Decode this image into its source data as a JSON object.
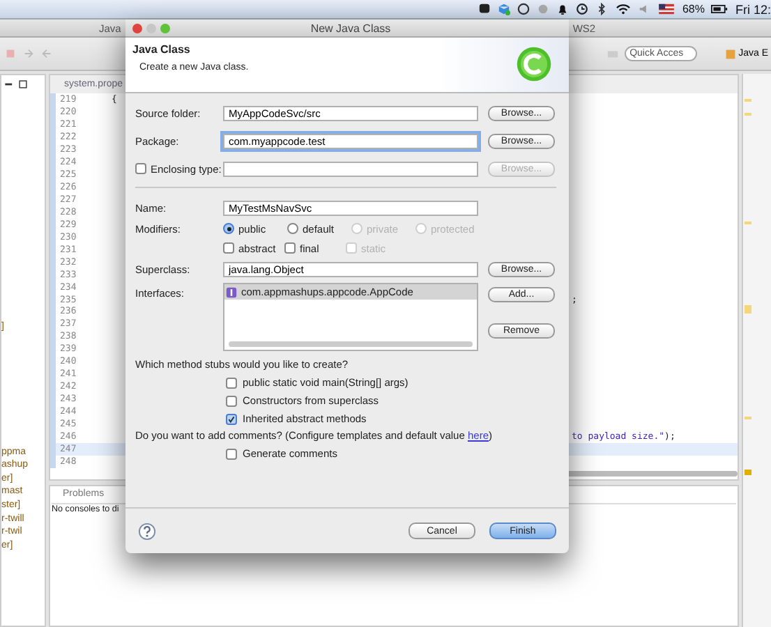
{
  "menubar": {
    "battery": "68%",
    "clock": "Fri 12:"
  },
  "window": {
    "title_left": "Java",
    "title_right": "WS2"
  },
  "toolbar": {
    "quick_access": {
      "placeholder": "Quick Acces"
    },
    "perspective": "Java E"
  },
  "left_panel": {
    "items": [
      {
        "text": "]",
        "selected": false
      },
      {
        "text": "ppma",
        "selected": false
      },
      {
        "text": "ashup",
        "selected": false
      },
      {
        "text": "er]",
        "selected": false
      },
      {
        "text": "mast",
        "selected": false
      },
      {
        "text": "ster]",
        "selected": false
      },
      {
        "text": "r-twill",
        "selected": false
      },
      {
        "text": "r-twil",
        "selected": false
      },
      {
        "text": "er]",
        "selected": false
      }
    ]
  },
  "editor": {
    "tab": "system.prope",
    "lines": [
      {
        "number": "219",
        "code": "{",
        "highlighted": false
      },
      {
        "number": "220",
        "highlighted": false
      },
      {
        "number": "221",
        "highlighted": false
      },
      {
        "number": "222",
        "highlighted": false
      },
      {
        "number": "223",
        "highlighted": false
      },
      {
        "number": "224",
        "highlighted": false
      },
      {
        "number": "225",
        "highlighted": false
      },
      {
        "number": "226",
        "highlighted": false
      },
      {
        "number": "227",
        "highlighted": false
      },
      {
        "number": "228",
        "highlighted": false
      },
      {
        "number": "229",
        "highlighted": false
      },
      {
        "number": "230",
        "highlighted": false
      },
      {
        "number": "231",
        "highlighted": false
      },
      {
        "number": "232",
        "highlighted": false
      },
      {
        "number": "233",
        "highlighted": false
      },
      {
        "number": "234",
        "highlighted": false
      },
      {
        "number": "235",
        "tail": ";",
        "highlighted": false
      },
      {
        "number": "236",
        "highlighted": false
      },
      {
        "number": "237",
        "highlighted": false
      },
      {
        "number": "238",
        "highlighted": false
      },
      {
        "number": "239",
        "highlighted": false
      },
      {
        "number": "240",
        "highlighted": false
      },
      {
        "number": "241",
        "highlighted": false
      },
      {
        "number": "242",
        "highlighted": false
      },
      {
        "number": "243",
        "highlighted": false
      },
      {
        "number": "244",
        "highlighted": false
      },
      {
        "number": "245",
        "highlighted": false
      },
      {
        "number": "246",
        "tail_string": "to payload size.\"",
        "tail": ");",
        "highlighted": false
      },
      {
        "number": "247",
        "highlighted": true
      },
      {
        "number": "248",
        "highlighted": false
      }
    ]
  },
  "bottom_panel": {
    "tab": "Problems",
    "message": "No consoles to di"
  },
  "dialog": {
    "title": "New Java Class",
    "header": {
      "title": "Java Class",
      "message": "Create a new Java class."
    },
    "rows": [
      {
        "kind": "field",
        "label": "Source folder:",
        "value": "MyAppCodeSvc/src",
        "focused": false,
        "button": "Browse...",
        "button_disabled": false
      },
      {
        "kind": "field",
        "label": "Package:",
        "value": "com.myappcode.test",
        "focused": true,
        "button": "Browse...",
        "button_disabled": false
      },
      {
        "kind": "check",
        "label": "Enclosing type:",
        "checked": false,
        "focused": false,
        "button": "Browse...",
        "button_disabled": true
      }
    ],
    "name": {
      "label": "Name:",
      "value": "MyTestMsNavSvc"
    },
    "modifiers": {
      "label": "Modifiers:",
      "access": [
        {
          "label": "public",
          "selected": true,
          "disabled": false
        },
        {
          "label": "default",
          "selected": false,
          "disabled": false
        },
        {
          "label": "private",
          "selected": false,
          "disabled": true
        },
        {
          "label": "protected",
          "selected": false,
          "disabled": true
        }
      ],
      "flags": [
        {
          "label": "abstract",
          "checked": false,
          "disabled": false
        },
        {
          "label": "final",
          "checked": false,
          "disabled": false
        },
        {
          "label": "static",
          "checked": false,
          "disabled": true
        }
      ]
    },
    "superclass": {
      "label": "Superclass:",
      "value": "java.lang.Object",
      "button": "Browse..."
    },
    "interfaces": {
      "label": "Interfaces:",
      "items": [
        {
          "text": "com.appmashups.appcode.AppCode",
          "selected": true
        }
      ],
      "add": "Add...",
      "remove": "Remove"
    },
    "stubs": {
      "question": "Which method stubs would you like to create?",
      "options": [
        {
          "label": "public static void main(String[] args)",
          "checked": false
        },
        {
          "label": "Constructors from superclass",
          "checked": false
        },
        {
          "label": "Inherited abstract methods",
          "checked": true
        }
      ]
    },
    "comments": {
      "question": "Do you want to add comments? (Configure templates and default value ",
      "link": "here",
      "question_end": ")",
      "options": [
        {
          "label": "Generate comments",
          "checked": false
        }
      ]
    },
    "buttons": [
      {
        "label": "Cancel",
        "default": false
      },
      {
        "label": "Finish",
        "default": true
      }
    ]
  }
}
